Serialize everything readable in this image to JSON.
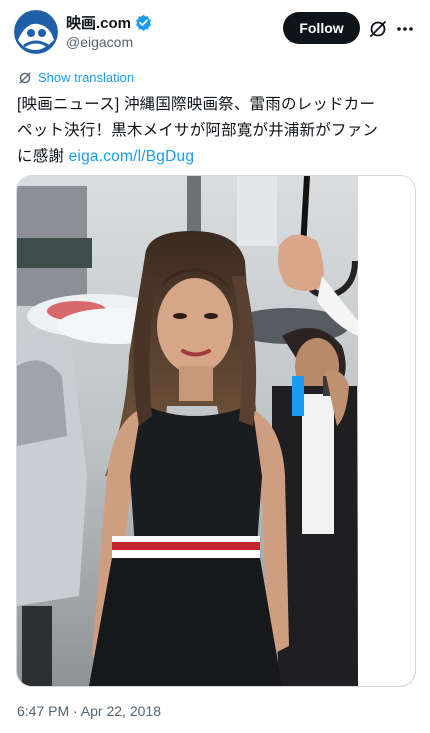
{
  "header": {
    "display_name": "映画.com",
    "handle": "@eigacom",
    "follow_label": "Follow",
    "verified": true
  },
  "tweet": {
    "translate_label": "Show translation",
    "text_line1": "[映画ニュース] 沖縄国際映画祭、雷雨のレッドカー",
    "text_line2": "ペット決行！黒木メイサが阿部寛が井浦新がファン",
    "text_line3_prefix": "に感謝 ",
    "link": "eiga.com/l/BgDug",
    "timestamp": "6:47 PM · Apr 22, 2018"
  },
  "colors": {
    "link": "#1d9bf0",
    "text": "#0f1419",
    "muted": "#536471",
    "follow_bg": "#0f1419",
    "verified_badge": "#1d9bf0"
  },
  "icons": [
    "avatar-logo-icon",
    "verified-badge-icon",
    "grok-icon",
    "more-icon",
    "translate-icon"
  ]
}
